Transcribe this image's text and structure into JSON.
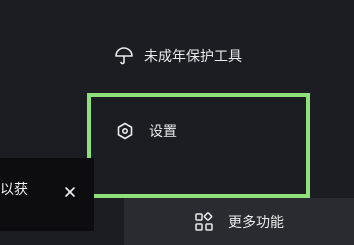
{
  "menu": {
    "youth_mode_tool": {
      "label": "未成年保护工具",
      "icon": "umbrella-icon"
    },
    "settings": {
      "label": "设置",
      "icon": "hexagon-settings-icon"
    },
    "more_functions": {
      "label": "更多功能",
      "icon": "grid-apps-icon"
    }
  },
  "toast": {
    "text": "以获",
    "close_icon": "close-icon"
  },
  "colors": {
    "background": "#1c1d22",
    "highlight": "#8fe07d",
    "more_bar": "#2a2b30",
    "toast_bg": "#0d0d10",
    "text": "#eaeaec"
  }
}
